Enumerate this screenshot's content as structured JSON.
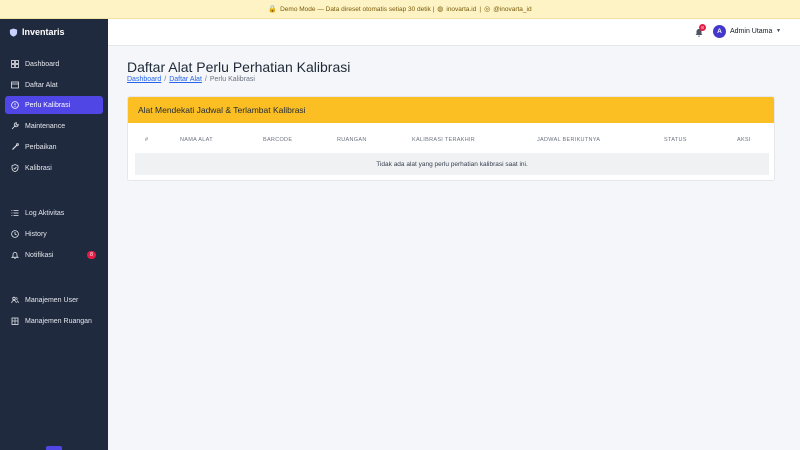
{
  "banner": {
    "text": "Demo Mode — Data direset otomatis setiap 30 detik | ",
    "link1": "inovarta.id",
    "sep": " | ",
    "link2": "@inovarta_id"
  },
  "sidebar": {
    "brand": "Inventaris",
    "items": [
      {
        "label": "Dashboard",
        "icon": "grid-icon"
      },
      {
        "label": "Daftar Alat",
        "icon": "box-icon"
      },
      {
        "label": "Perlu Kalibrasi",
        "icon": "alert-circle-icon",
        "active": true
      },
      {
        "label": "Maintenance",
        "icon": "wrench-icon"
      },
      {
        "label": "Perbaikan",
        "icon": "tool-icon"
      },
      {
        "label": "Kalibrasi",
        "icon": "shield-check-icon"
      },
      {
        "label": "Log Aktivitas",
        "icon": "list-icon"
      },
      {
        "label": "History",
        "icon": "clock-icon"
      },
      {
        "label": "Notifikasi",
        "icon": "bell-icon",
        "badge": "8"
      },
      {
        "label": "Manajemen User",
        "icon": "users-icon"
      },
      {
        "label": "Manajemen Ruangan",
        "icon": "building-icon"
      }
    ]
  },
  "topbar": {
    "notification_count": "8",
    "avatar_initial": "A",
    "user_name": "Admin Utama"
  },
  "page": {
    "title": "Daftar Alat Perlu Perhatian Kalibrasi",
    "breadcrumb": [
      "Dashboard",
      "Daftar Alat",
      "Perlu Kalibrasi"
    ]
  },
  "card": {
    "header": "Alat Mendekati Jadwal & Terlambat Kalibrasi",
    "columns": [
      "#",
      "NAMA ALAT",
      "BARCODE",
      "RUANGAN",
      "KALIBRASI TERAKHIR",
      "JADWAL BERIKUTNYA",
      "STATUS",
      "AKSI"
    ],
    "empty_message": "Tidak ada alat yang perlu perhatian kalibrasi saat ini."
  },
  "colors": {
    "sidebar_bg": "#1f2a3f",
    "accent": "#4f46e5",
    "card_header": "#fbbf24",
    "badge": "#e11d48"
  }
}
